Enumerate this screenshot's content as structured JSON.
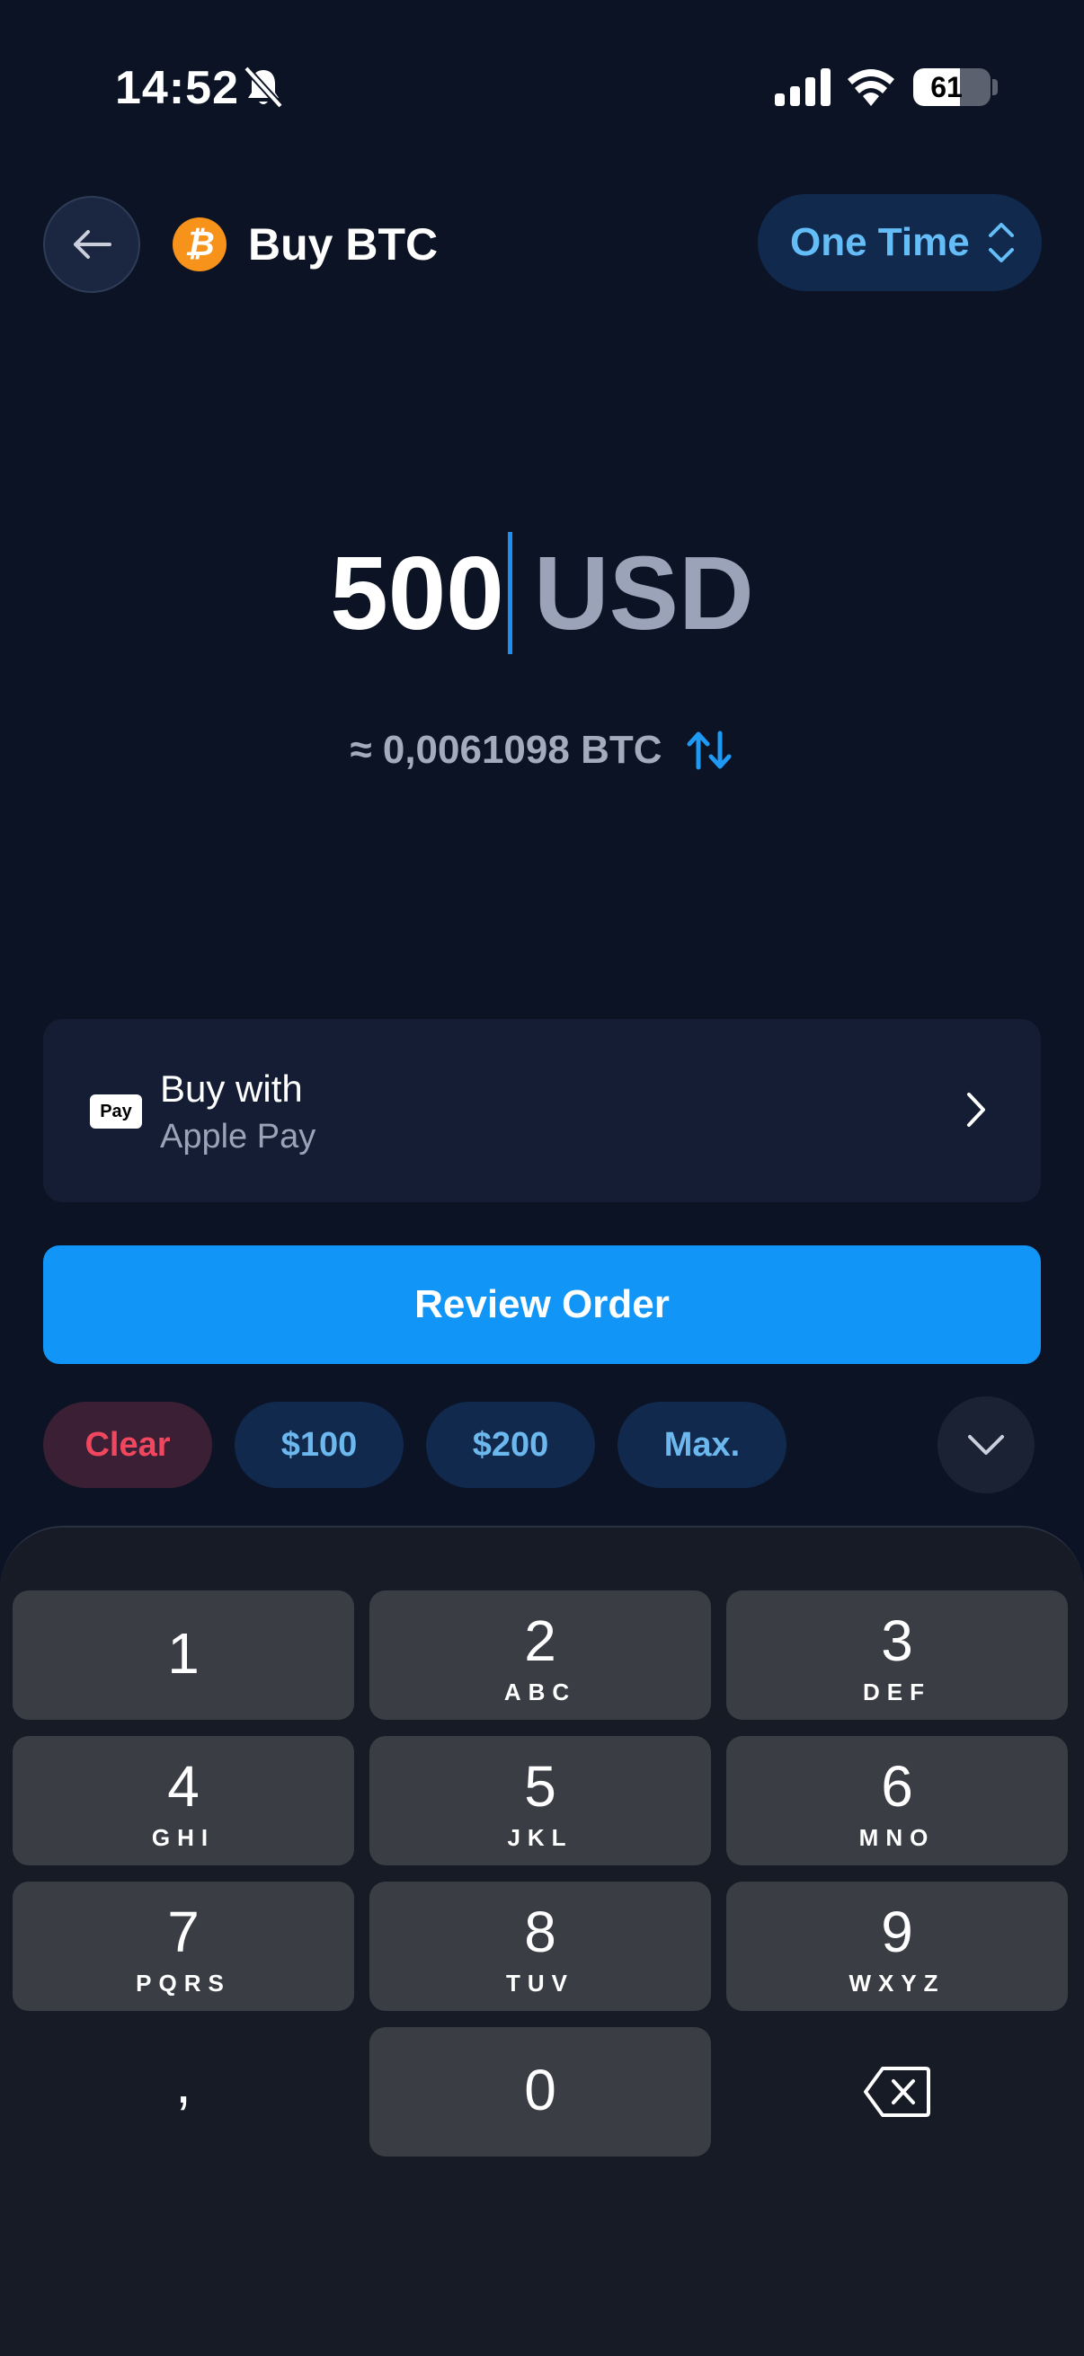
{
  "status_bar": {
    "time": "14:52",
    "battery_percent": 61,
    "battery_label": "61",
    "icons": [
      "bell-muted-icon",
      "signal-icon",
      "wifi-icon",
      "battery-icon"
    ]
  },
  "header": {
    "title": "Buy BTC",
    "asset_symbol": "₿",
    "frequency": "One Time",
    "icons": [
      "arrow-left-icon",
      "bitcoin-icon",
      "chevron-updown-icon"
    ]
  },
  "amount": {
    "value": "500",
    "currency": "USD",
    "converted": "≈ 0,0061098 BTC"
  },
  "payment": {
    "title": "Buy with",
    "method": "Apple Pay",
    "badge": "Pay"
  },
  "review_button": "Review Order",
  "quick_amounts": {
    "clear": "Clear",
    "preset_1": "$100",
    "preset_2": "$200",
    "max": "Max."
  },
  "keypad": {
    "keys": [
      {
        "num": "1",
        "letters": ""
      },
      {
        "num": "2",
        "letters": "ABC"
      },
      {
        "num": "3",
        "letters": "DEF"
      },
      {
        "num": "4",
        "letters": "GHI"
      },
      {
        "num": "5",
        "letters": "JKL"
      },
      {
        "num": "6",
        "letters": "MNO"
      },
      {
        "num": "7",
        "letters": "PQRS"
      },
      {
        "num": "8",
        "letters": "TUV"
      },
      {
        "num": "9",
        "letters": "WXYZ"
      },
      {
        "num": "0",
        "letters": ""
      }
    ],
    "decimal": ","
  },
  "colors": {
    "background": "#0b1324",
    "accent": "#1196f7",
    "bitcoin": "#f7931a",
    "clear": "#f0475f"
  }
}
